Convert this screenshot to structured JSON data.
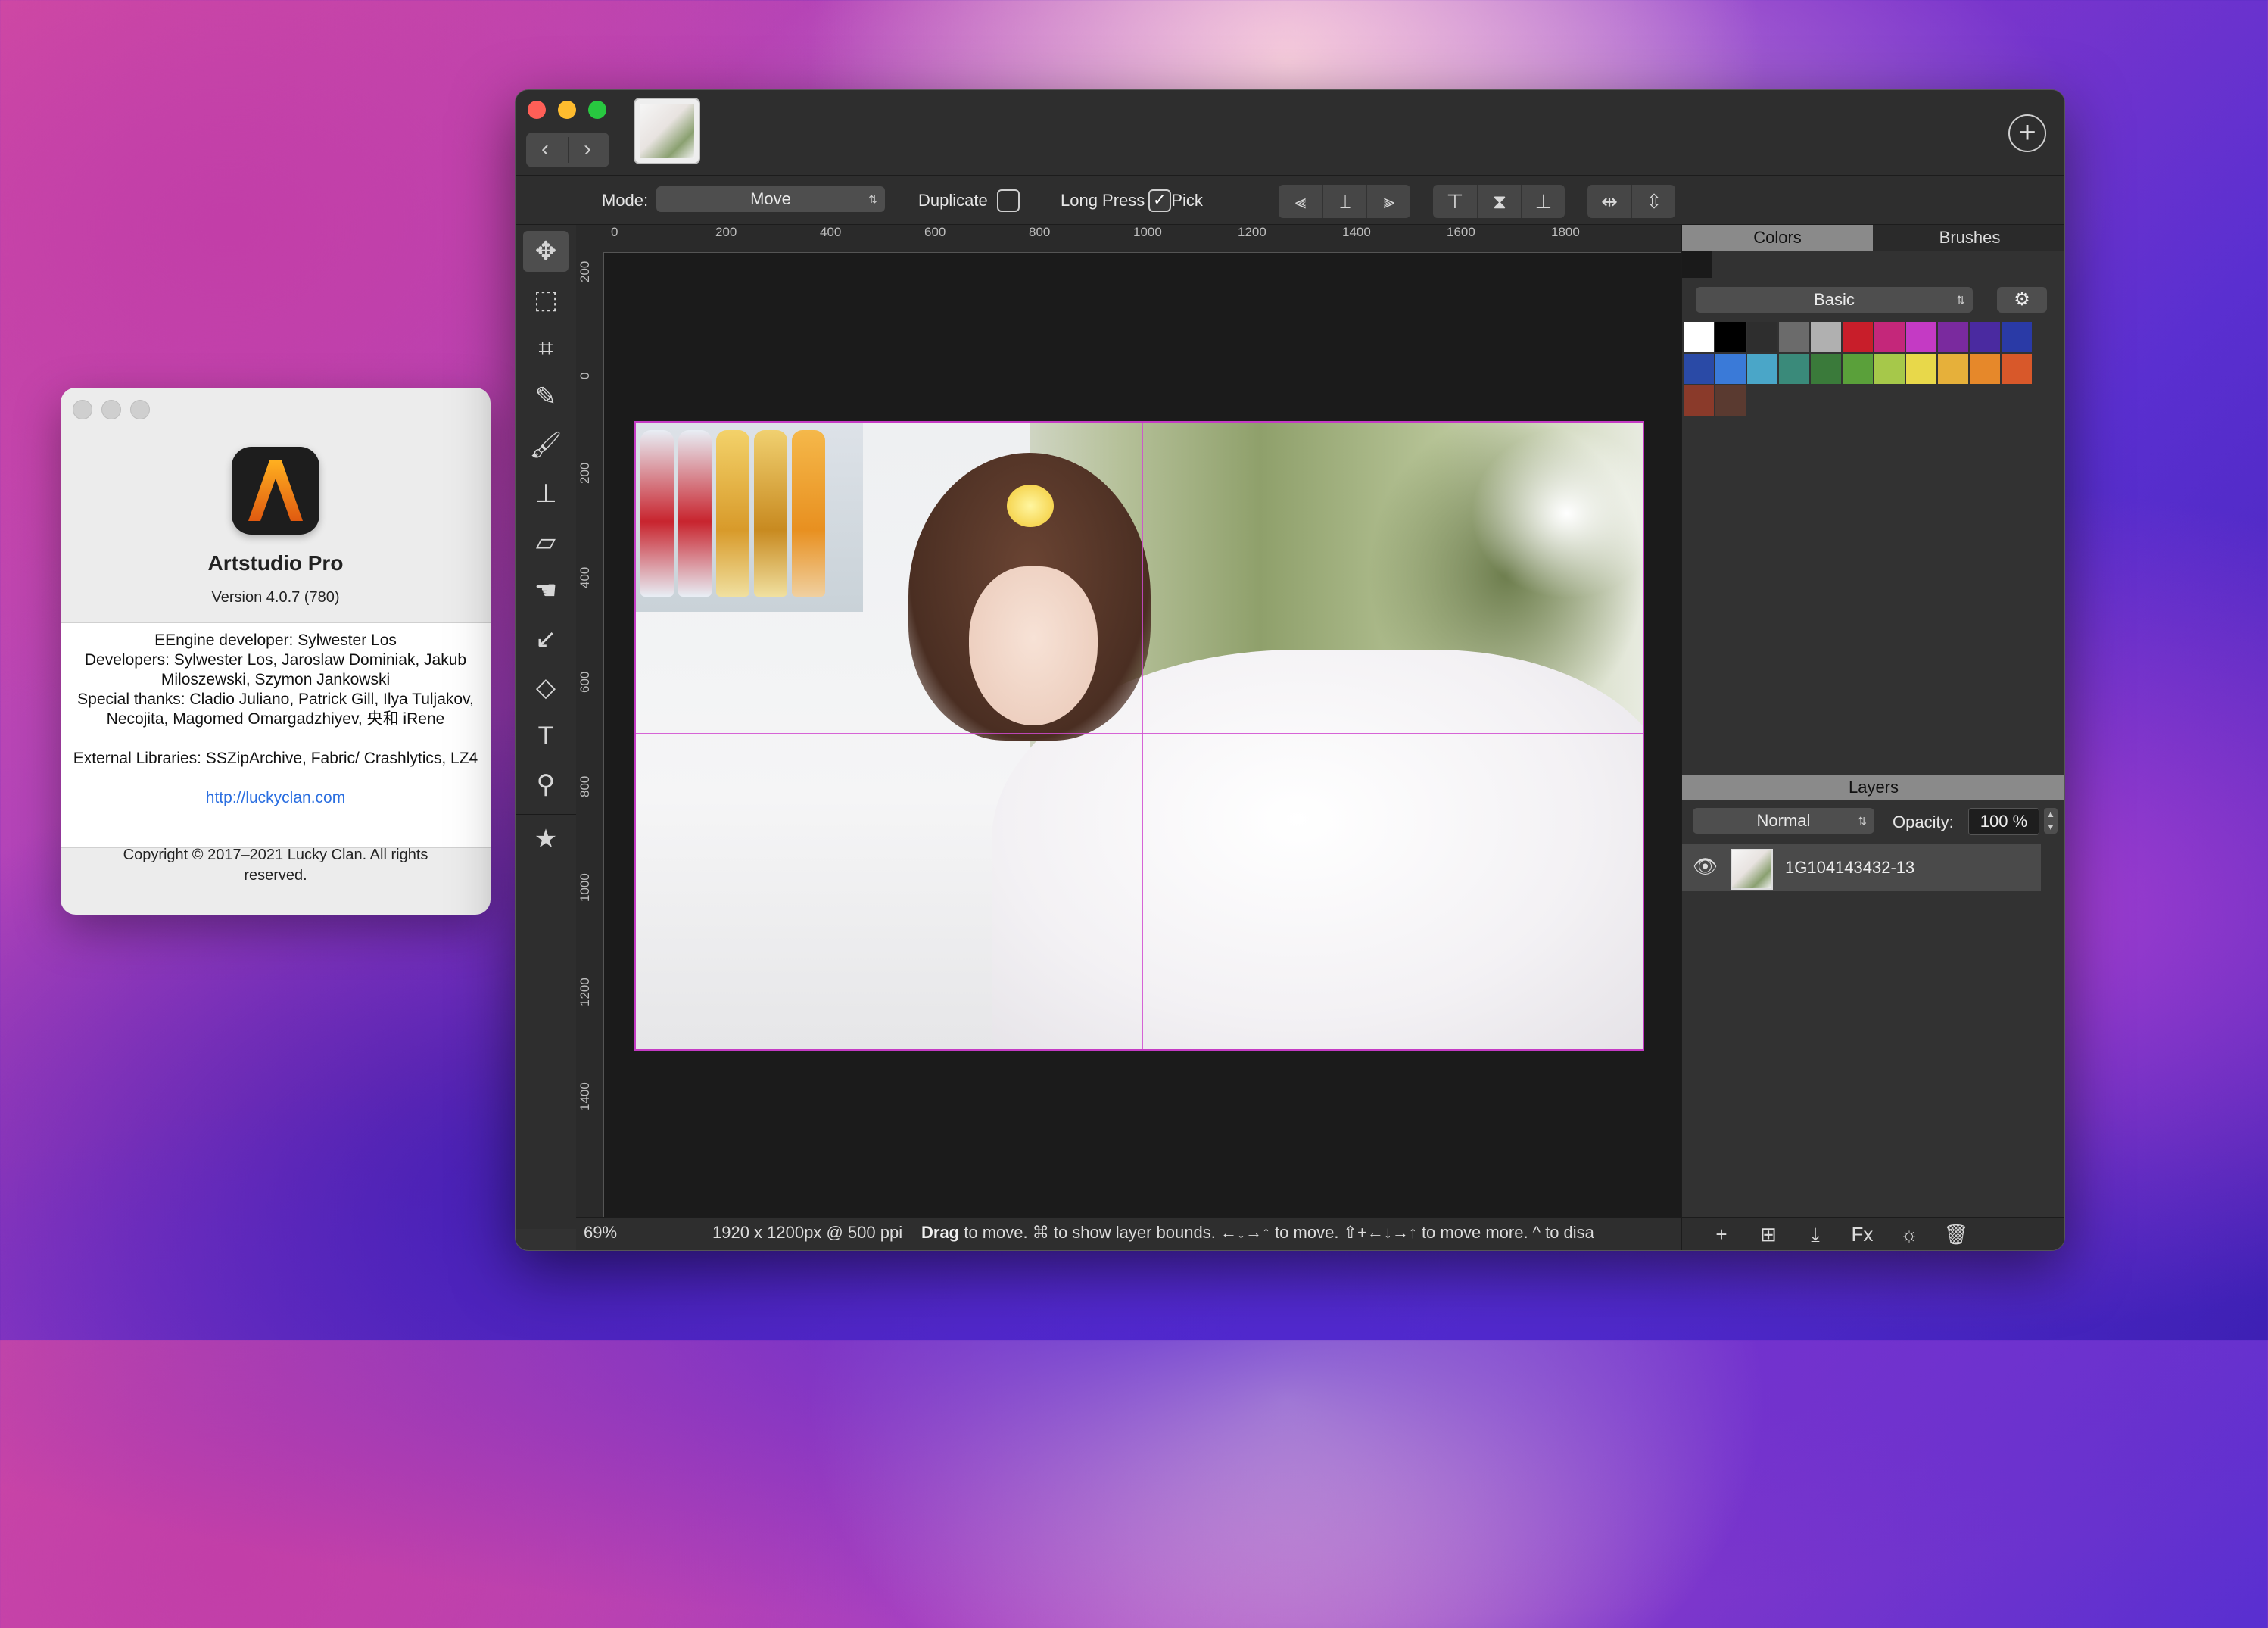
{
  "about": {
    "app_name": "Artstudio Pro",
    "version": "Version 4.0.7 (780)",
    "credits": [
      "EEngine developer: Sylwester Los",
      "Developers: Sylwester Los, Jaroslaw Dominiak, Jakub Miloszewski, Szymon Jankowski",
      "Special thanks: Cladio Juliano, Patrick Gill, Ilya Tuljakov, Necojita, Magomed Omargadzhiyev, 央和 iRene",
      "",
      "External Libraries: SSZipArchive, Fabric/ Crashlytics, LZ4",
      "",
      "http://luckyclan.com"
    ],
    "copyright": "Copyright © 2017–2021 Lucky Clan. All rights reserved."
  },
  "window": {
    "add_icon": "plus-circle-icon",
    "nav_back": "‹",
    "nav_forward": "›"
  },
  "options": {
    "mode_label": "Mode:",
    "mode_value": "Move",
    "duplicate_label": "Duplicate",
    "duplicate_checked": false,
    "longpress_label": "Long Press To Pick",
    "longpress_checked": true
  },
  "tools": [
    {
      "name": "move-tool",
      "glyph": "✥"
    },
    {
      "name": "selection-tool",
      "glyph": "⬚"
    },
    {
      "name": "crop-tool",
      "glyph": "⌗"
    },
    {
      "name": "eyedropper-tool",
      "glyph": "✎"
    },
    {
      "name": "brush-tool",
      "glyph": "🖌"
    },
    {
      "name": "stamp-tool",
      "glyph": "⊥"
    },
    {
      "name": "eraser-tool",
      "glyph": "▱"
    },
    {
      "name": "smudge-tool",
      "glyph": "☚"
    },
    {
      "name": "blur-tool",
      "glyph": "↙"
    },
    {
      "name": "fill-tool",
      "glyph": "◇"
    },
    {
      "name": "text-tool",
      "glyph": "T"
    },
    {
      "name": "zoom-tool",
      "glyph": "⚲"
    },
    {
      "name": "favorites-tool",
      "glyph": "★"
    }
  ],
  "ruler_h": [
    "0",
    "200",
    "400",
    "600",
    "800",
    "1000",
    "1200",
    "1400",
    "1600",
    "1800"
  ],
  "ruler_v": [
    "200",
    "0",
    "200",
    "400",
    "600",
    "800",
    "1000",
    "1200",
    "1400"
  ],
  "status": {
    "zoom": "69%",
    "doc_info": "1920 x 1200px @ 500 ppi",
    "hint_bold": "Drag",
    "hint": " to move.  ⌘ to show layer bounds.  ←↓→↑ to move.  ⇧+←↓→↑ to move more.  ^ to disa"
  },
  "panel": {
    "tab_colors": "Colors",
    "tab_brushes": "Brushes",
    "palette": "Basic",
    "swatches": [
      "#ffffff",
      "#000000",
      "#2e2e2e",
      "#6b6b6b",
      "#b0b0b0",
      "#c81e2a",
      "#c4277a",
      "#c43ac4",
      "#7a2a9e",
      "#4a2aa0",
      "#2a3aa6",
      "#2a4aa6",
      "#3a7ad8",
      "#4aa6c8",
      "#3a8a7a",
      "#3a7a3a",
      "#5aa03a",
      "#a6c84a",
      "#e8d84a",
      "#e6b03a",
      "#e6882a",
      "#d8582a",
      "#8a3a2a",
      "#5a3a30"
    ],
    "layers_title": "Layers",
    "blend_mode": "Normal",
    "opacity_label": "Opacity:",
    "opacity_value": "100 %",
    "layers": [
      {
        "name": "1G104143432-13",
        "visible": true
      }
    ]
  }
}
